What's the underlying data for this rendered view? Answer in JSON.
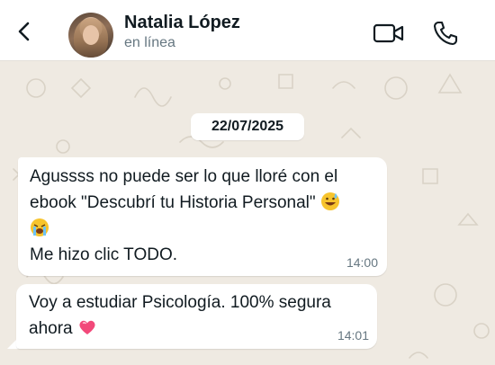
{
  "header": {
    "contact_name": "Natalia López",
    "contact_status": "en línea"
  },
  "chat": {
    "date_chip": "22/07/2025",
    "messages": [
      {
        "line1": "Agussss no puede ser lo que lloré con el",
        "line2": "ebook \"Descubrí tu Historia Personal\"",
        "line3": "Me hizo clic TODO.",
        "time": "14:00"
      },
      {
        "line1": "Voy a estudiar Psicología. 100% segura",
        "line2": "ahora",
        "time": "14:01"
      }
    ]
  },
  "colors": {
    "wallpaper": "#efeae2",
    "bubble": "#ffffff",
    "secondary_text": "#667781"
  }
}
